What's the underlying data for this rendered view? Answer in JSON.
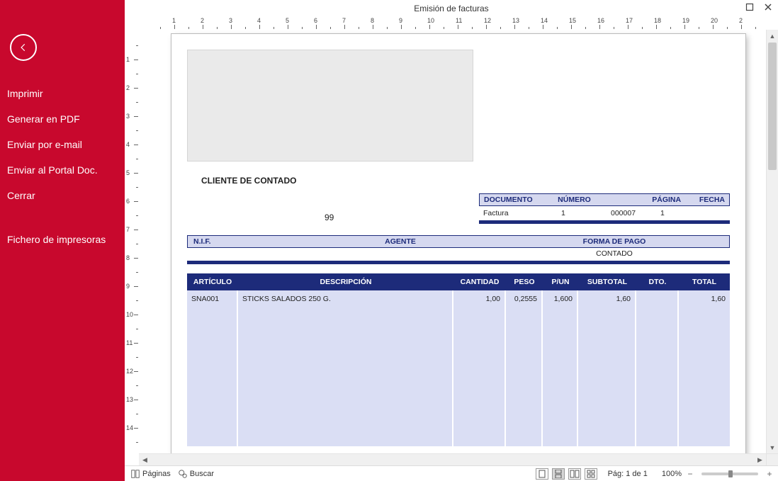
{
  "titlebar": {
    "title": "Emisión de facturas"
  },
  "sidebar": {
    "items": [
      {
        "label": "Imprimir"
      },
      {
        "label": "Generar en PDF"
      },
      {
        "label": "Enviar por e-mail"
      },
      {
        "label": "Enviar al Portal Doc."
      },
      {
        "label": "Cerrar"
      },
      {
        "label": "Fichero de impresoras"
      }
    ]
  },
  "ruler": {
    "h_labels": [
      "1",
      "2",
      "3",
      "4",
      "5",
      "6",
      "7",
      "8",
      "9",
      "10",
      "11",
      "12",
      "13",
      "14",
      "15",
      "16",
      "17",
      "18",
      "19",
      "20",
      "2"
    ],
    "v_labels": [
      "1",
      "2",
      "3",
      "4",
      "5",
      "6",
      "7",
      "8",
      "9",
      "10",
      "11",
      "12",
      "13",
      "14"
    ]
  },
  "invoice": {
    "client_label": "CLIENTE DE CONTADO",
    "code": "99",
    "doc_headers": {
      "documento": "DOCUMENTO",
      "numero": "NÚMERO",
      "pagina": "PÁGINA",
      "fecha": "FECHA"
    },
    "doc_values": {
      "documento": "Factura",
      "numero_series": "1",
      "numero": "000007",
      "pagina": "1",
      "fecha": ""
    },
    "info_headers": {
      "nif": "N.I.F.",
      "agente": "AGENTE",
      "forma_pago": "FORMA DE PAGO"
    },
    "info_values": {
      "nif": "",
      "agente": "",
      "forma_pago": "CONTADO"
    },
    "item_headers": {
      "articulo": "ARTÍCULO",
      "descripcion": "DESCRIPCIÓN",
      "cantidad": "CANTIDAD",
      "peso": "PESO",
      "pun": "P/UN",
      "subtotal": "SUBTOTAL",
      "dto": "DTO.",
      "total": "TOTAL"
    },
    "items": [
      {
        "articulo": "SNA001",
        "descripcion": "STICKS SALADOS 250 G.",
        "cantidad": "1,00",
        "peso": "0,2555",
        "pun": "1,600",
        "subtotal": "1,60",
        "dto": "",
        "total": "1,60"
      }
    ]
  },
  "statusbar": {
    "paginas": "Páginas",
    "buscar": "Buscar",
    "page_info": "Pág: 1 de 1",
    "zoom": "100%"
  }
}
